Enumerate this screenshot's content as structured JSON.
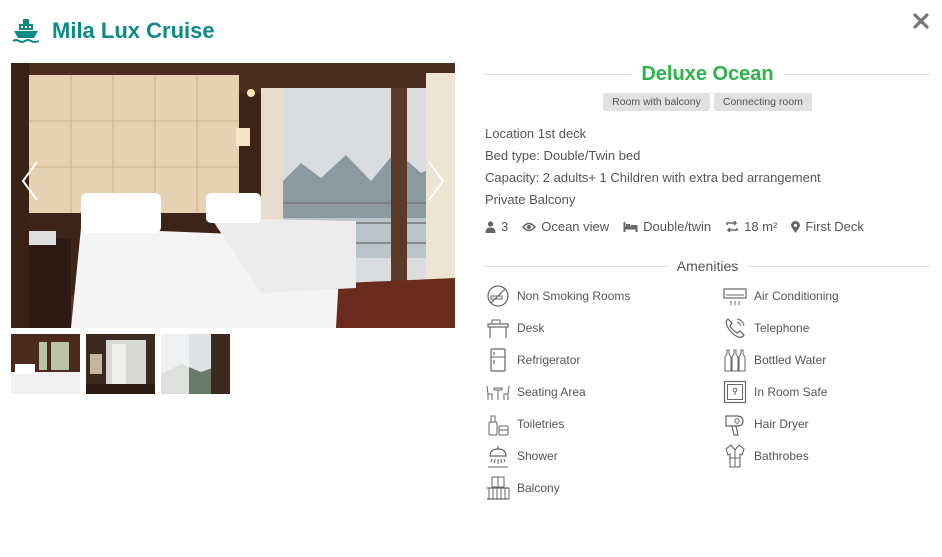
{
  "header": {
    "title": "Mila Lux Cruise",
    "icon": "ship-icon"
  },
  "room": {
    "name": "Deluxe Ocean",
    "tags": [
      "Room with balcony",
      "Connecting room"
    ],
    "details": [
      "Location 1st deck",
      "Bed type: Double/Twin bed",
      "Capacity: 2 adults+ 1 Children with extra bed arrangement",
      "Private Balcony"
    ],
    "features": [
      {
        "icon": "people-icon",
        "label": "3"
      },
      {
        "icon": "eye-icon",
        "label": "Ocean view"
      },
      {
        "icon": "bed-icon",
        "label": "Double/twin"
      },
      {
        "icon": "area-icon",
        "label": "18 m²"
      },
      {
        "icon": "map-pin-icon",
        "label": "First Deck"
      }
    ]
  },
  "amenities": {
    "title": "Amenities",
    "items": [
      {
        "icon": "no-smoking-icon",
        "label": "Non Smoking Rooms"
      },
      {
        "icon": "air-conditioner-icon",
        "label": "Air Conditioning"
      },
      {
        "icon": "desk-icon",
        "label": "Desk"
      },
      {
        "icon": "telephone-icon",
        "label": "Telephone"
      },
      {
        "icon": "refrigerator-icon",
        "label": "Refrigerator"
      },
      {
        "icon": "bottled-water-icon",
        "label": "Bottled Water"
      },
      {
        "icon": "seating-area-icon",
        "label": "Seating Area"
      },
      {
        "icon": "safe-icon",
        "label": "In Room Safe"
      },
      {
        "icon": "toiletries-icon",
        "label": "Toiletries"
      },
      {
        "icon": "hair-dryer-icon",
        "label": "Hair Dryer"
      },
      {
        "icon": "shower-icon",
        "label": "Shower"
      },
      {
        "icon": "bathrobe-icon",
        "label": "Bathrobes"
      },
      {
        "icon": "balcony-icon",
        "label": "Balcony"
      }
    ]
  },
  "colors": {
    "brand": "#0d8a84",
    "room_title": "#2db34a",
    "tag_bg": "#e1e1e1"
  }
}
